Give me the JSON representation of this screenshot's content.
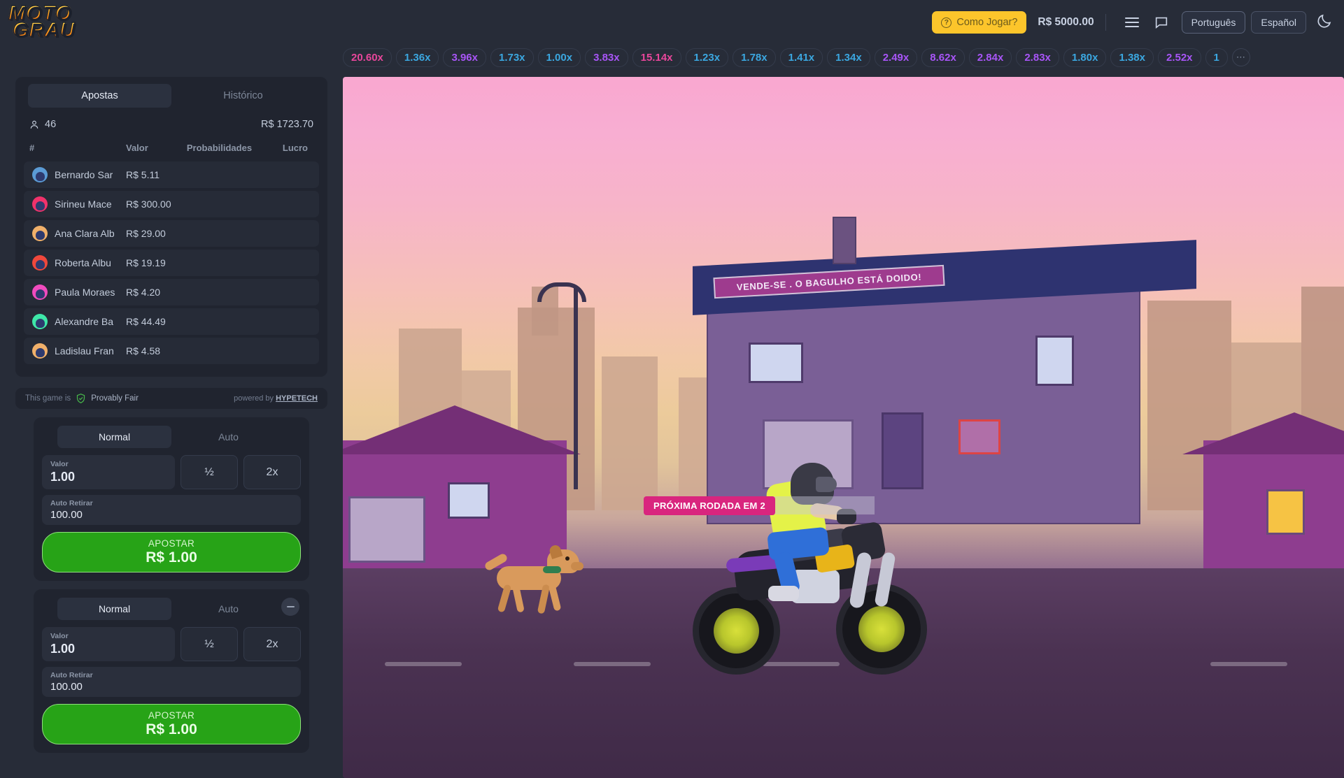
{
  "header": {
    "logo_line1": "MOTO",
    "logo_line2": "GRAU",
    "how_to_play": "Como Jogar?",
    "help_icon": "question-circle-icon",
    "balance": "R$ 5000.00",
    "menu_icon": "hamburger-menu-icon",
    "chat_icon": "chat-bubble-icon",
    "lang_pt": "Português",
    "lang_es": "Español",
    "theme_icon": "moon-icon"
  },
  "multipliers": {
    "items": [
      {
        "label": "20.60x",
        "tone": "pink"
      },
      {
        "label": "1.36x",
        "tone": "blue"
      },
      {
        "label": "3.96x",
        "tone": "purple"
      },
      {
        "label": "1.73x",
        "tone": "blue"
      },
      {
        "label": "1.00x",
        "tone": "blue"
      },
      {
        "label": "3.83x",
        "tone": "purple"
      },
      {
        "label": "15.14x",
        "tone": "pink"
      },
      {
        "label": "1.23x",
        "tone": "blue"
      },
      {
        "label": "1.78x",
        "tone": "blue"
      },
      {
        "label": "1.41x",
        "tone": "blue"
      },
      {
        "label": "1.34x",
        "tone": "blue"
      },
      {
        "label": "2.49x",
        "tone": "purple"
      },
      {
        "label": "8.62x",
        "tone": "purple"
      },
      {
        "label": "2.84x",
        "tone": "purple"
      },
      {
        "label": "2.83x",
        "tone": "purple"
      },
      {
        "label": "1.80x",
        "tone": "blue"
      },
      {
        "label": "1.38x",
        "tone": "blue"
      },
      {
        "label": "2.52x",
        "tone": "purple"
      },
      {
        "label": "1",
        "tone": "blue"
      }
    ],
    "more_label": "⋯"
  },
  "bets_panel": {
    "tab_bets": "Apostas",
    "tab_history": "Histórico",
    "players_icon": "person-icon",
    "players_count": "46",
    "total_amount": "R$ 1723.70",
    "columns": {
      "num": "#",
      "value": "Valor",
      "odds": "Probabilidades",
      "profit": "Lucro"
    },
    "rows": [
      {
        "name": "Bernardo Sar",
        "value": "R$ 5.11",
        "odds": "",
        "profit": "",
        "avatar": "#5b9bd5"
      },
      {
        "name": "Sirineu Mace",
        "value": "R$ 300.00",
        "odds": "",
        "profit": "",
        "avatar": "#f0326b"
      },
      {
        "name": "Ana Clara Alb",
        "value": "R$ 29.00",
        "odds": "",
        "profit": "",
        "avatar": "#f0b06a"
      },
      {
        "name": "Roberta Albu",
        "value": "R$ 19.19",
        "odds": "",
        "profit": "",
        "avatar": "#f0483c"
      },
      {
        "name": "Paula Moraes",
        "value": "R$ 4.20",
        "odds": "",
        "profit": "",
        "avatar": "#f04bbe"
      },
      {
        "name": "Alexandre Ba",
        "value": "R$ 44.49",
        "odds": "",
        "profit": "",
        "avatar": "#3ee7a8"
      },
      {
        "name": "Ladislau Fran",
        "value": "R$ 4.58",
        "odds": "",
        "profit": "",
        "avatar": "#f0b06a"
      }
    ]
  },
  "fair": {
    "prefix": "This game is",
    "shield_icon": "shield-check-icon",
    "label": "Provably Fair",
    "powered_prefix": "powered by",
    "powered_brand": "HYPETECH"
  },
  "bet_forms": [
    {
      "tab_normal": "Normal",
      "tab_auto": "Auto",
      "amount_label": "Valor",
      "amount_value": "1.00",
      "half_label": "½",
      "double_label": "2x",
      "autocash_label": "Auto Retirar",
      "autocash_value": "100.00",
      "bet_label": "APOSTAR",
      "bet_amount": "R$ 1.00",
      "has_remove": false
    },
    {
      "tab_normal": "Normal",
      "tab_auto": "Auto",
      "amount_label": "Valor",
      "amount_value": "1.00",
      "half_label": "½",
      "double_label": "2x",
      "autocash_label": "Auto Retirar",
      "autocash_value": "100.00",
      "bet_label": "APOSTAR",
      "bet_amount": "R$ 1.00",
      "has_remove": true,
      "remove_icon": "minus-circle-icon"
    }
  ],
  "game": {
    "next_round_badge": "PRÓXIMA RODADA EM 2",
    "house_sign": "VENDE-SE . O BAGULHO ESTÁ DOIDO!",
    "rider_icon": "motorcycle-rider",
    "dog_icon": "dog",
    "lamp_icon": "street-lamp"
  },
  "colors": {
    "accent_yellow": "#fcc52b",
    "bet_green": "#27a317",
    "badge_pink": "#d9257e",
    "bg_dark": "#272c38",
    "card_bg": "#20242f"
  }
}
